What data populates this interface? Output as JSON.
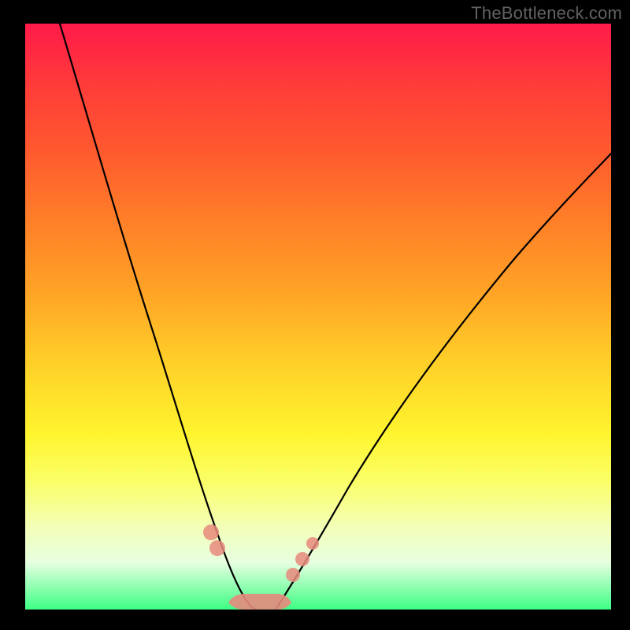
{
  "watermark": {
    "text": "TheBottleneck.com"
  },
  "chart_data": {
    "type": "line",
    "title": "",
    "xlabel": "",
    "ylabel": "",
    "grid": false,
    "legend": false,
    "xlim": [
      0,
      100
    ],
    "ylim": [
      0,
      100
    ],
    "background_gradient": {
      "direction": "vertical",
      "stops": [
        {
          "pos": 0,
          "color": "#ff1a4a"
        },
        {
          "pos": 50,
          "color": "#ffb428"
        },
        {
          "pos": 75,
          "color": "#fff42e"
        },
        {
          "pos": 100,
          "color": "#3dff84"
        }
      ]
    },
    "series": [
      {
        "name": "left-curve",
        "x": [
          6,
          10,
          14,
          18,
          22,
          26,
          29,
          32,
          35,
          37
        ],
        "y": [
          100,
          80,
          62,
          46,
          33,
          22,
          14,
          8,
          3,
          0
        ]
      },
      {
        "name": "right-curve",
        "x": [
          42,
          45,
          50,
          56,
          63,
          72,
          82,
          92,
          100
        ],
        "y": [
          0,
          3,
          8,
          15,
          24,
          35,
          48,
          60,
          70
        ]
      }
    ],
    "markers": [
      {
        "series": "left-curve",
        "x": 31,
        "y": 12,
        "r": 10
      },
      {
        "series": "left-curve",
        "x": 32,
        "y": 9,
        "r": 10
      },
      {
        "series": "right-curve",
        "x": 44,
        "y": 6,
        "r": 9
      },
      {
        "series": "right-curve",
        "x": 46,
        "y": 9,
        "r": 9
      },
      {
        "series": "right-curve",
        "x": 48,
        "y": 12,
        "r": 8
      }
    ],
    "bottom_highlight": {
      "x0": 34,
      "x1": 43,
      "y": 0,
      "thickness": 2.6
    }
  }
}
